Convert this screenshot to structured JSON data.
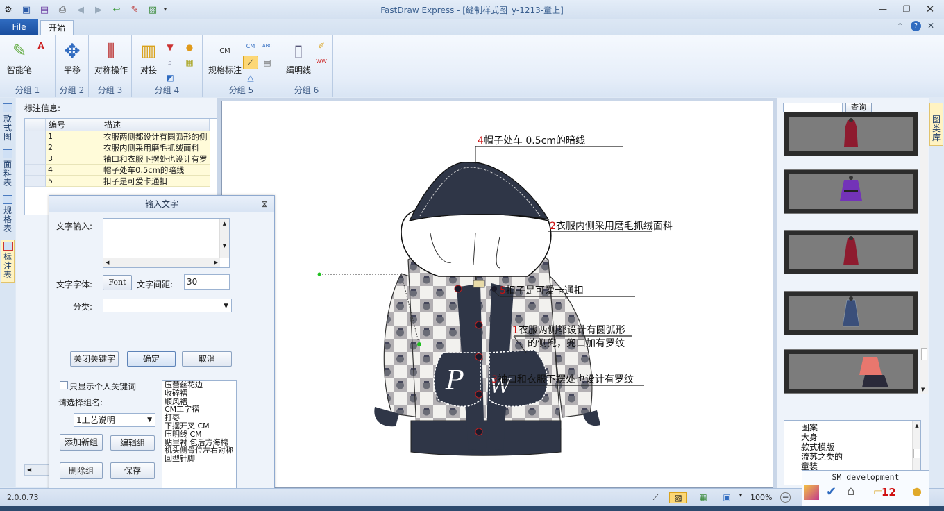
{
  "app": {
    "title": "FastDraw Express - [缝制样式图_y-1213-童上]"
  },
  "tabs": {
    "file": "File",
    "home": "开始"
  },
  "ribbon": {
    "groups": [
      "分组 1",
      "分组 2",
      "分组 3",
      "分组 4",
      "分组 5",
      "分组 6"
    ],
    "smart_pen": "智能笔",
    "pan": "平移",
    "symmetric": "对称操作",
    "align": "对接",
    "spec_mark": "规格标注",
    "stitch_line": "缉明线",
    "icon_cm": "CM",
    "icon_abc": "ABC",
    "icon_ww": "WW"
  },
  "vtabs": [
    "款式图",
    "面料表",
    "规格表",
    "标注表"
  ],
  "left": {
    "label": "标注信息:",
    "table": {
      "headers": [
        "编号",
        "描述"
      ],
      "rows": [
        {
          "id": "1",
          "desc": "衣服两侧都设计有圆弧形的侧"
        },
        {
          "id": "2",
          "desc": "衣服内侧采用磨毛抓绒面料"
        },
        {
          "id": "3",
          "desc": "袖口和衣服下摆处也设计有罗"
        },
        {
          "id": "4",
          "desc": "帽子处车0.5cm的暗线"
        },
        {
          "id": "5",
          "desc": "扣子是可爱卡通扣"
        }
      ]
    }
  },
  "dialog": {
    "title": "输入文字",
    "text_input_label": "文字输入:",
    "font_label": "文字字体:",
    "font_button": "Font",
    "spacing_label": "文字间距:",
    "spacing_value": "30",
    "category_label": "分类:",
    "close_keyword": "关闭关键字",
    "ok": "确定",
    "cancel": "取消",
    "only_personal": "只显示个人关键词",
    "choose_group": "请选择组名:",
    "group_value": "1工艺说明",
    "add_group": "添加新组",
    "edit_group": "编辑组",
    "delete_group": "删除组",
    "save": "保存",
    "keywords": [
      "压蕾丝花边",
      "收碎褶",
      "顺风褶",
      "CM工字褶",
      "打枣",
      "下摆开叉 CM",
      "压明线 CM",
      "贴里衬 包后方海棉",
      "机头侧骨位左右对称",
      "回型针脚"
    ]
  },
  "canvas": {
    "annotations": [
      {
        "n": "4",
        "text": "帽子处车 0.5cm的暗线"
      },
      {
        "n": "2",
        "text": "衣服内侧采用磨毛抓绒面料"
      },
      {
        "n": "5",
        "text": "扣子是可爱卡通扣"
      },
      {
        "n": "1",
        "text": "衣服两侧都设计有圆弧形",
        "text2": "的侧兜，兜口加有罗纹"
      },
      {
        "n": "3",
        "text": "袖口和衣服下摆处也设计有罗纹"
      }
    ],
    "pocket_text": "P W"
  },
  "right": {
    "search_button": "查询",
    "tree": [
      "图案",
      "大身",
      "款式模版",
      "流苏之类的",
      "童装"
    ],
    "vtab": "图类库"
  },
  "status": {
    "version": "2.0.0.73",
    "zoom": "100%"
  },
  "notify": {
    "title": "SM development",
    "count": "12"
  },
  "colors": {
    "accent": "#1b4f9f",
    "annotation_number": "#cc1010",
    "hood": "#2f3647"
  }
}
